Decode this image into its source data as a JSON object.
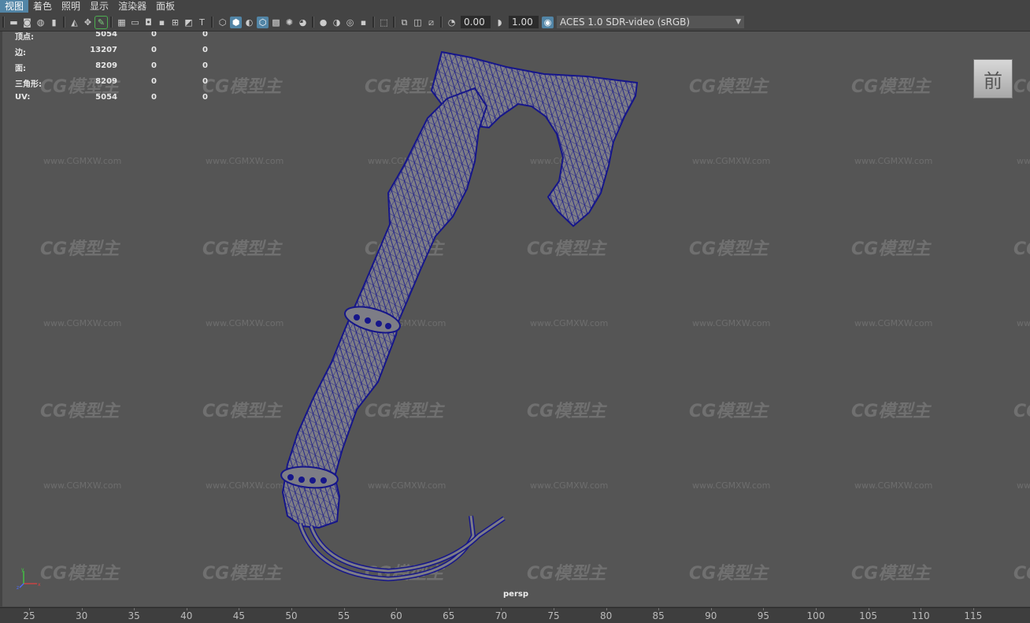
{
  "menu": [
    "视图",
    "着色",
    "照明",
    "显示",
    "渲染器",
    "面板"
  ],
  "toolbar": {
    "icons": [
      "select-camera-icon",
      "camera-attributes-icon",
      "bookmark-icon",
      "image-plane-icon",
      "two-d-pan-icon",
      "grease-pencil-icon",
      "grid-icon",
      "film-gate-icon",
      "resolution-gate-icon",
      "gate-mask-icon",
      "field-chart-icon",
      "safe-action-icon",
      "safe-title-icon",
      "wireframe-icon",
      "smooth-shade-icon",
      "default-material-icon",
      "wireframe-on-shaded-icon",
      "xray-icon",
      "use-all-lights-icon",
      "shadows-icon",
      "screen-space-ao-icon",
      "motion-blur-icon",
      "multisample-aa-icon",
      "depth-of-field-icon",
      "isolate-select-icon",
      "xray-joints-icon",
      "xray-active-icon",
      "backface-culling-icon",
      "exposure-icon",
      "gamma-icon",
      "color-management-icon"
    ],
    "exposure": "0.00",
    "gamma": "1.00",
    "color_space": "ACES 1.0 SDR-video (sRGB)"
  },
  "hud": {
    "rows": [
      {
        "label": "顶点:",
        "v1": "5054",
        "v2": "0",
        "v3": "0"
      },
      {
        "label": "边:",
        "v1": "13207",
        "v2": "0",
        "v3": "0"
      },
      {
        "label": "面:",
        "v1": "8209",
        "v2": "0",
        "v3": "0"
      },
      {
        "label": "三角形:",
        "v1": "8209",
        "v2": "0",
        "v3": "0"
      },
      {
        "label": "UV:",
        "v1": "5054",
        "v2": "0",
        "v3": "0"
      }
    ]
  },
  "viewport": {
    "camera_label": "persp",
    "viewcube_label": "前",
    "axis_labels": [
      "x",
      "y",
      "z"
    ]
  },
  "watermark": {
    "brand": "CG模型主",
    "url": "www.CGMXW.com"
  },
  "timeline": {
    "ticks": [
      "25",
      "30",
      "35",
      "40",
      "45",
      "50",
      "55",
      "60",
      "65",
      "70",
      "75",
      "80",
      "85",
      "90",
      "95",
      "100",
      "105",
      "110",
      "115",
      "12"
    ]
  },
  "colors": {
    "wireframe": "#16168a",
    "mesh_fill": "#7d7d86",
    "viewport_bg": "#555555",
    "highlight": "#5285a6"
  }
}
